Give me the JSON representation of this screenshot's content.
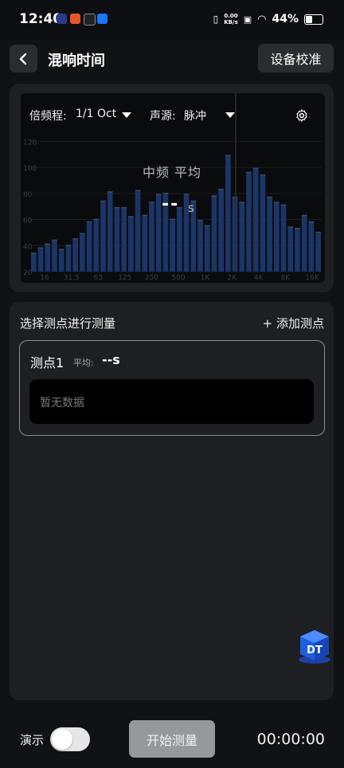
{
  "status_bar": {
    "time": "12:40",
    "net_speed_value": "0.00",
    "net_speed_unit": "KB/s",
    "battery": "44%"
  },
  "header": {
    "title": "混响时间",
    "calibrate_label": "设备校准"
  },
  "chart": {
    "octave_label": "倍频程:",
    "octave_value": "1/1 Oct",
    "source_label": "声源:",
    "source_value": "脉冲",
    "overlay_label": "中频 平均",
    "overlay_value": "--",
    "overlay_unit": "s"
  },
  "chart_data": {
    "type": "bar",
    "ytick_labels": [
      "20",
      "40",
      "60",
      "80",
      "100",
      "120"
    ],
    "ylim": [
      20,
      130
    ],
    "xtick_labels": [
      "16",
      "31.5",
      "63",
      "125",
      "250",
      "500",
      "1K",
      "2K",
      "4K",
      "8K",
      "16K"
    ],
    "bar_color": "#1a3566",
    "values": [
      34,
      38,
      41,
      44,
      37,
      40,
      45,
      49,
      58,
      60,
      74,
      81,
      69,
      69,
      62,
      82,
      63,
      73,
      79,
      80,
      60,
      69,
      79,
      74,
      59,
      55,
      78,
      83,
      109,
      77,
      73,
      96,
      99,
      94,
      77,
      73,
      71,
      54,
      53,
      63,
      58,
      50
    ]
  },
  "measure": {
    "section_title": "选择测点进行测量",
    "add_point_label": "+ 添加测点",
    "point": {
      "name": "测点1",
      "avg_label": "平均:",
      "avg_value": "--s",
      "empty_text": "暂无数据"
    },
    "badge_text": "DT"
  },
  "bottom": {
    "demo_label": "演示",
    "demo_on": false,
    "start_label": "开始测量",
    "timer": "00:00:00"
  },
  "colors": {
    "accent_blue": "#1a3566",
    "card_bg": "#1e1f22",
    "button_bg": "#2b2c30"
  }
}
